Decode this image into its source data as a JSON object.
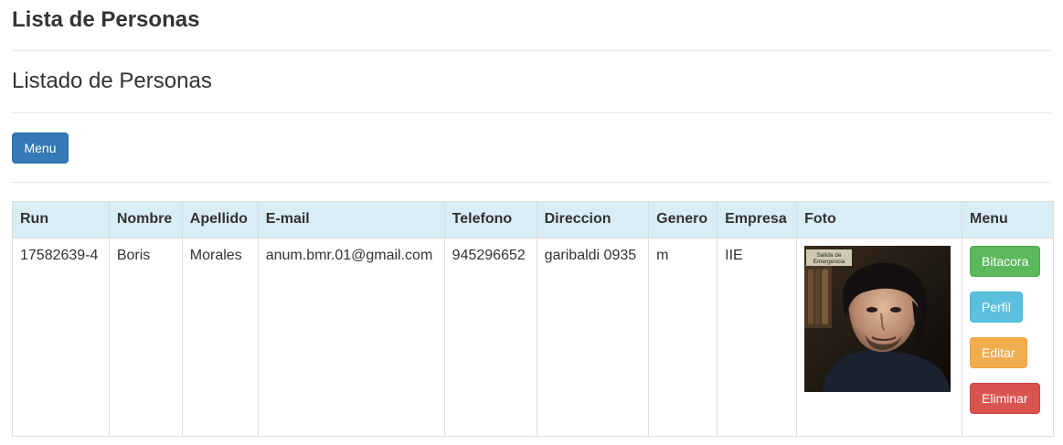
{
  "page": {
    "title": "Lista de Personas",
    "subtitle": "Listado de Personas",
    "menu_button": "Menu"
  },
  "table": {
    "headers": [
      "Run",
      "Nombre",
      "Apellido",
      "E-mail",
      "Telefono",
      "Direccion",
      "Genero",
      "Empresa",
      "Foto",
      "Menu"
    ],
    "rows": [
      {
        "run": "17582639-4",
        "nombre": "Boris",
        "apellido": "Morales",
        "email": "anum.bmr.01@gmail.com",
        "telefono": "945296652",
        "direccion": "garibaldi 0935",
        "genero": "m",
        "empresa": "IIE",
        "foto_sign": "Salida de Emergencia",
        "actions": {
          "bitacora": "Bitacora",
          "perfil": "Perfil",
          "editar": "Editar",
          "eliminar": "Eliminar"
        }
      }
    ]
  },
  "colors": {
    "primary": "#337ab7",
    "success": "#5cb85c",
    "info": "#5bc0de",
    "warning": "#f0ad4e",
    "danger": "#d9534f",
    "header_bg": "#d9edf7"
  }
}
